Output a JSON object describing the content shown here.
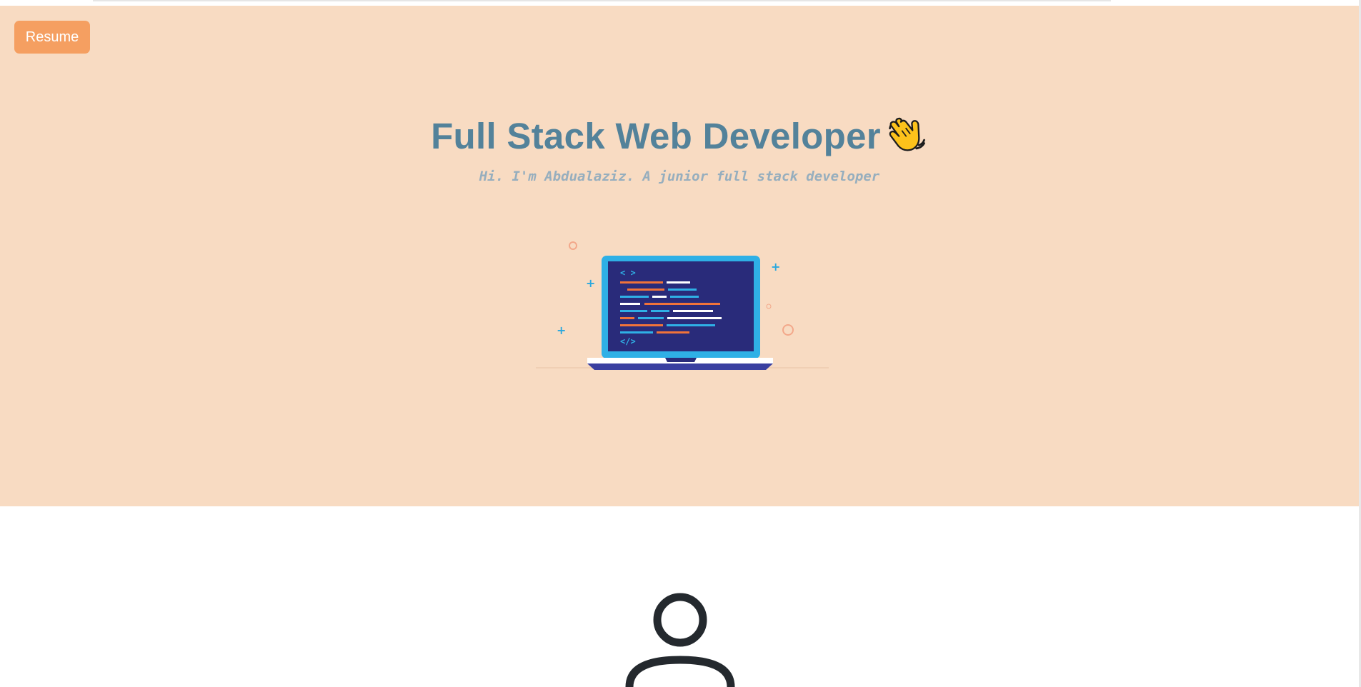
{
  "header": {
    "resume_label": "Resume"
  },
  "hero": {
    "title": "Full Stack Web Developer",
    "title_icon": "waving-hand-icon",
    "subtitle": "Hi. I'm Abdualaziz. A junior full stack developer",
    "illustration": "laptop-code-icon"
  },
  "profile": {
    "avatar_icon": "user-avatar-icon"
  },
  "colors": {
    "hero_background": "#f8dbc2",
    "button": "#f59f61",
    "title": "#53829a",
    "subtitle": "#96aebe"
  }
}
